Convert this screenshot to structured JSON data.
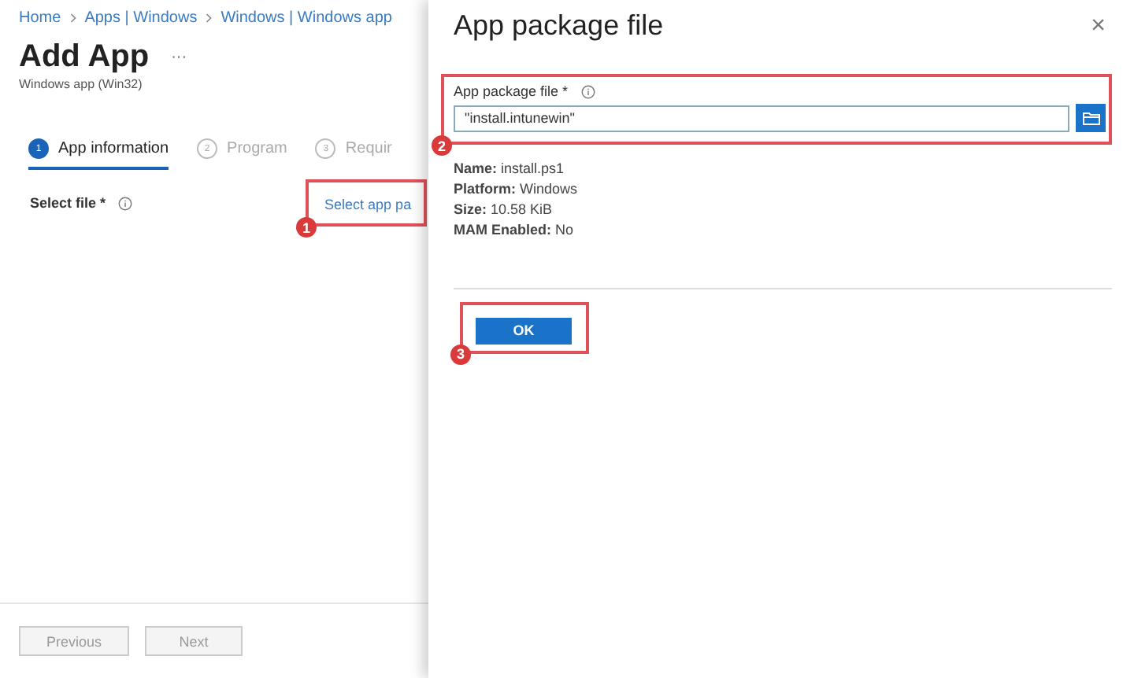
{
  "breadcrumbs": [
    "Home",
    "Apps | Windows",
    "Windows | Windows app"
  ],
  "page": {
    "title": "Add App",
    "more": "···",
    "subtitle": "Windows app (Win32)"
  },
  "steps": [
    {
      "number": "1",
      "label": "App information",
      "selected": true
    },
    {
      "number": "2",
      "label": "Program",
      "selected": false
    },
    {
      "number": "3",
      "label": "Requir",
      "selected": false
    }
  ],
  "select_file": {
    "label": "Select file *",
    "link": "Select app pa",
    "callout": "1"
  },
  "footer_buttons": [
    {
      "label": "Previous",
      "disabled": true
    },
    {
      "label": "Next",
      "disabled": true
    }
  ],
  "panel": {
    "title": "App package file",
    "close": "×",
    "field": {
      "label": "App package file *",
      "value": "\"install.intunewin\"",
      "callout": "2"
    },
    "details": [
      "**Name:** install.ps1",
      "**Platform:** Windows",
      "**Size:** 10.58 KiB",
      "**MAM Enabled:** No"
    ],
    "ok": {
      "label": "OK",
      "callout": "3"
    }
  }
}
